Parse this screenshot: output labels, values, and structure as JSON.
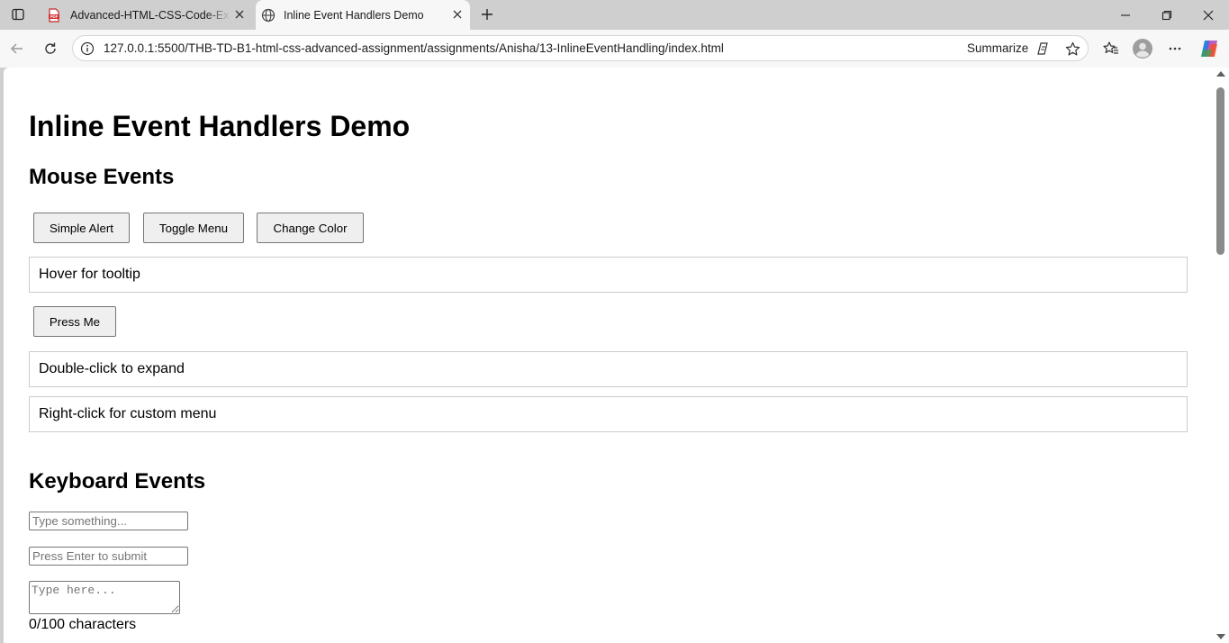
{
  "browser": {
    "tabs": [
      {
        "title": "Advanced-HTML-CSS-Code-Examples",
        "icon": "pdf-icon",
        "active": false
      },
      {
        "title": "Inline Event Handlers Demo",
        "icon": "globe-icon",
        "active": true
      }
    ],
    "url": "127.0.0.1:5500/THB-TD-B1-html-css-advanced-assignment/assignments/Anisha/13-InlineEventHandling/index.html",
    "summarize_label": "Summarize",
    "accent_color": "#0078d4"
  },
  "page": {
    "title": "Inline Event Handlers Demo",
    "mouse_section": {
      "heading": "Mouse Events",
      "buttons": {
        "alert": "Simple Alert",
        "toggle": "Toggle Menu",
        "color": "Change Color"
      },
      "tooltip_box": "Hover for tooltip",
      "press_button": "Press Me",
      "dblclick_box": "Double-click to expand",
      "contextmenu_box": "Right-click for custom menu"
    },
    "keyboard_section": {
      "heading": "Keyboard Events",
      "type_placeholder": "Type something...",
      "enter_placeholder": "Press Enter to submit",
      "textarea_placeholder": "Type here...",
      "char_counter": "0/100 characters"
    }
  }
}
